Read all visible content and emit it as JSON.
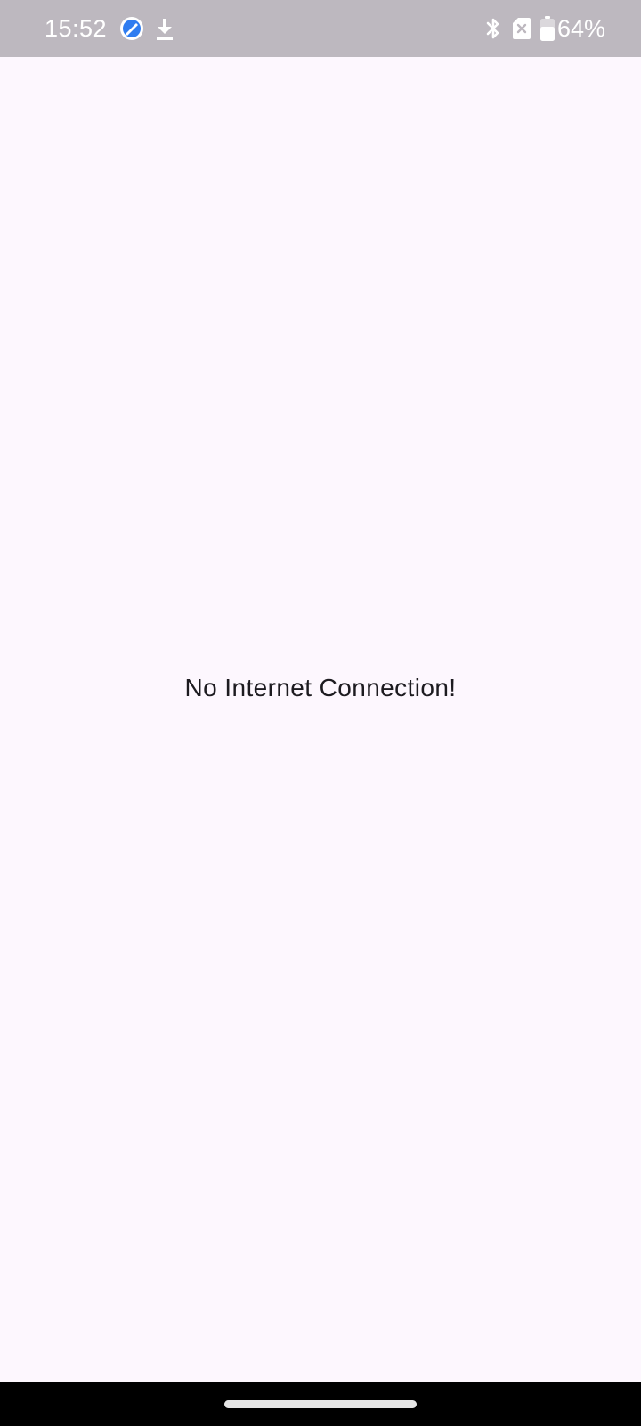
{
  "status_bar": {
    "time": "15:52",
    "battery_percent": "64%",
    "icons": [
      "browser-app-icon",
      "download-icon",
      "bluetooth-icon",
      "no-sim-icon",
      "battery-icon"
    ],
    "battery_level": 0.64
  },
  "main": {
    "message": "No Internet Connection!"
  },
  "colors": {
    "status_bar_bg": "#bdb8bf",
    "page_bg": "#fdf7fe",
    "text": "#1d1b20",
    "nav_bar_bg": "#000000"
  }
}
